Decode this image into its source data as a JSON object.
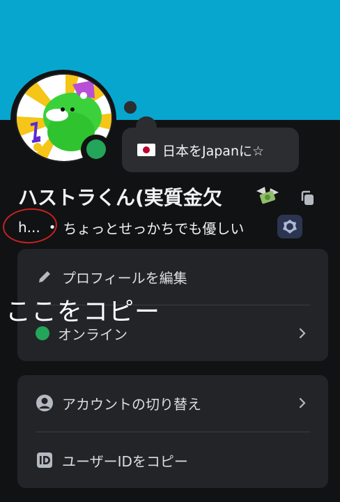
{
  "profile": {
    "display_name": "ハストラくん(実質金欠",
    "name_emoji": "money-with-wings-emoji",
    "username": "h...",
    "separator": "•",
    "bio": "ちょっとせっかちでも優しい",
    "status": "online",
    "status_color": "#23a55a",
    "banner_color": "#07a6cf"
  },
  "custom_status": {
    "text": "日本をJapanに☆",
    "emoji": "japan-flag-emoji"
  },
  "annotation": {
    "text": "ここをコピー",
    "color": "#c5221f"
  },
  "menu_primary": {
    "edit_profile": "プロフィールを編集",
    "status_label": "オンライン"
  },
  "menu_secondary": {
    "switch_accounts": "アカウントの切り替え",
    "copy_user_id": "ユーザーIDをコピー"
  },
  "icons": [
    "copy-icon",
    "nitro-badge-icon",
    "pencil-icon",
    "chevron-right-icon",
    "account-circle-icon",
    "id-card-icon"
  ]
}
